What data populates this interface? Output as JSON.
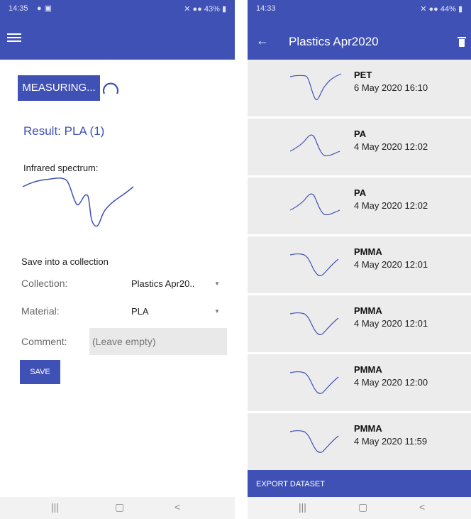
{
  "left": {
    "status": {
      "time": "14:35",
      "battery": "43%"
    },
    "measure_button": "MEASURING...",
    "result": "Result: PLA (1)",
    "spectrum_label": "Infrared spectrum:",
    "save_section": {
      "title": "Save into a collection",
      "collection_label": "Collection:",
      "collection_value": "Plastics Apr20..",
      "material_label": "Material:",
      "material_value": "PLA",
      "comment_label": "Comment:",
      "comment_placeholder": "(Leave empty)",
      "save_button": "SAVE"
    }
  },
  "right": {
    "status": {
      "time": "14:33",
      "battery": "44%"
    },
    "title": "Plastics Apr2020",
    "items": [
      {
        "material": "PET",
        "date": "6 May 2020 16:10"
      },
      {
        "material": "PA",
        "date": "4 May 2020 12:02"
      },
      {
        "material": "PA",
        "date": "4 May 2020 12:02"
      },
      {
        "material": "PMMA",
        "date": "4 May 2020 12:01"
      },
      {
        "material": "PMMA",
        "date": "4 May 2020 12:01"
      },
      {
        "material": "PMMA",
        "date": "4 May 2020 12:00"
      },
      {
        "material": "PMMA",
        "date": "4 May 2020 11:59"
      }
    ],
    "export_button": "EXPORT DATASET"
  },
  "colors": {
    "primary": "#3f51b5",
    "list_bg": "#ececec",
    "field_bg": "#e9e9e9"
  },
  "icons": [
    "menu-icon",
    "back-arrow-icon",
    "trash-icon",
    "recents-icon",
    "home-icon",
    "nav-back-icon"
  ]
}
